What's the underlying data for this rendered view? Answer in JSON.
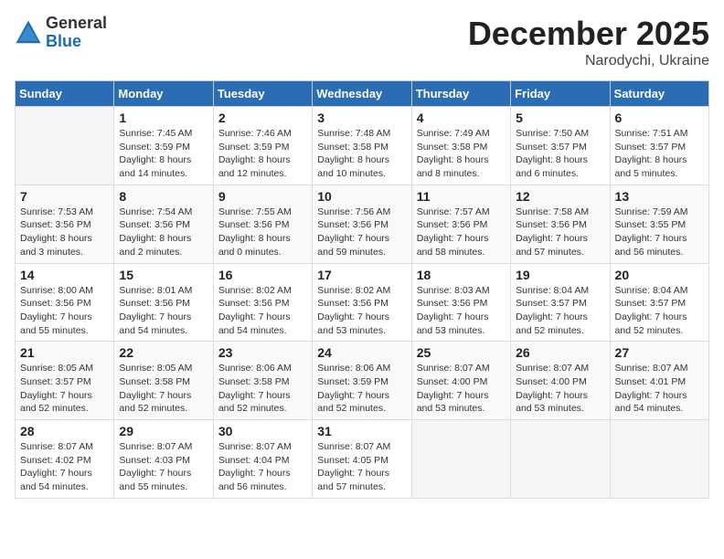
{
  "header": {
    "logo_general": "General",
    "logo_blue": "Blue",
    "month_title": "December 2025",
    "subtitle": "Narodychi, Ukraine"
  },
  "calendar": {
    "days_of_week": [
      "Sunday",
      "Monday",
      "Tuesday",
      "Wednesday",
      "Thursday",
      "Friday",
      "Saturday"
    ],
    "weeks": [
      [
        {
          "day": "",
          "info": ""
        },
        {
          "day": "1",
          "info": "Sunrise: 7:45 AM\nSunset: 3:59 PM\nDaylight: 8 hours\nand 14 minutes."
        },
        {
          "day": "2",
          "info": "Sunrise: 7:46 AM\nSunset: 3:59 PM\nDaylight: 8 hours\nand 12 minutes."
        },
        {
          "day": "3",
          "info": "Sunrise: 7:48 AM\nSunset: 3:58 PM\nDaylight: 8 hours\nand 10 minutes."
        },
        {
          "day": "4",
          "info": "Sunrise: 7:49 AM\nSunset: 3:58 PM\nDaylight: 8 hours\nand 8 minutes."
        },
        {
          "day": "5",
          "info": "Sunrise: 7:50 AM\nSunset: 3:57 PM\nDaylight: 8 hours\nand 6 minutes."
        },
        {
          "day": "6",
          "info": "Sunrise: 7:51 AM\nSunset: 3:57 PM\nDaylight: 8 hours\nand 5 minutes."
        }
      ],
      [
        {
          "day": "7",
          "info": "Sunrise: 7:53 AM\nSunset: 3:56 PM\nDaylight: 8 hours\nand 3 minutes."
        },
        {
          "day": "8",
          "info": "Sunrise: 7:54 AM\nSunset: 3:56 PM\nDaylight: 8 hours\nand 2 minutes."
        },
        {
          "day": "9",
          "info": "Sunrise: 7:55 AM\nSunset: 3:56 PM\nDaylight: 8 hours\nand 0 minutes."
        },
        {
          "day": "10",
          "info": "Sunrise: 7:56 AM\nSunset: 3:56 PM\nDaylight: 7 hours\nand 59 minutes."
        },
        {
          "day": "11",
          "info": "Sunrise: 7:57 AM\nSunset: 3:56 PM\nDaylight: 7 hours\nand 58 minutes."
        },
        {
          "day": "12",
          "info": "Sunrise: 7:58 AM\nSunset: 3:56 PM\nDaylight: 7 hours\nand 57 minutes."
        },
        {
          "day": "13",
          "info": "Sunrise: 7:59 AM\nSunset: 3:55 PM\nDaylight: 7 hours\nand 56 minutes."
        }
      ],
      [
        {
          "day": "14",
          "info": "Sunrise: 8:00 AM\nSunset: 3:56 PM\nDaylight: 7 hours\nand 55 minutes."
        },
        {
          "day": "15",
          "info": "Sunrise: 8:01 AM\nSunset: 3:56 PM\nDaylight: 7 hours\nand 54 minutes."
        },
        {
          "day": "16",
          "info": "Sunrise: 8:02 AM\nSunset: 3:56 PM\nDaylight: 7 hours\nand 54 minutes."
        },
        {
          "day": "17",
          "info": "Sunrise: 8:02 AM\nSunset: 3:56 PM\nDaylight: 7 hours\nand 53 minutes."
        },
        {
          "day": "18",
          "info": "Sunrise: 8:03 AM\nSunset: 3:56 PM\nDaylight: 7 hours\nand 53 minutes."
        },
        {
          "day": "19",
          "info": "Sunrise: 8:04 AM\nSunset: 3:57 PM\nDaylight: 7 hours\nand 52 minutes."
        },
        {
          "day": "20",
          "info": "Sunrise: 8:04 AM\nSunset: 3:57 PM\nDaylight: 7 hours\nand 52 minutes."
        }
      ],
      [
        {
          "day": "21",
          "info": "Sunrise: 8:05 AM\nSunset: 3:57 PM\nDaylight: 7 hours\nand 52 minutes."
        },
        {
          "day": "22",
          "info": "Sunrise: 8:05 AM\nSunset: 3:58 PM\nDaylight: 7 hours\nand 52 minutes."
        },
        {
          "day": "23",
          "info": "Sunrise: 8:06 AM\nSunset: 3:58 PM\nDaylight: 7 hours\nand 52 minutes."
        },
        {
          "day": "24",
          "info": "Sunrise: 8:06 AM\nSunset: 3:59 PM\nDaylight: 7 hours\nand 52 minutes."
        },
        {
          "day": "25",
          "info": "Sunrise: 8:07 AM\nSunset: 4:00 PM\nDaylight: 7 hours\nand 53 minutes."
        },
        {
          "day": "26",
          "info": "Sunrise: 8:07 AM\nSunset: 4:00 PM\nDaylight: 7 hours\nand 53 minutes."
        },
        {
          "day": "27",
          "info": "Sunrise: 8:07 AM\nSunset: 4:01 PM\nDaylight: 7 hours\nand 54 minutes."
        }
      ],
      [
        {
          "day": "28",
          "info": "Sunrise: 8:07 AM\nSunset: 4:02 PM\nDaylight: 7 hours\nand 54 minutes."
        },
        {
          "day": "29",
          "info": "Sunrise: 8:07 AM\nSunset: 4:03 PM\nDaylight: 7 hours\nand 55 minutes."
        },
        {
          "day": "30",
          "info": "Sunrise: 8:07 AM\nSunset: 4:04 PM\nDaylight: 7 hours\nand 56 minutes."
        },
        {
          "day": "31",
          "info": "Sunrise: 8:07 AM\nSunset: 4:05 PM\nDaylight: 7 hours\nand 57 minutes."
        },
        {
          "day": "",
          "info": ""
        },
        {
          "day": "",
          "info": ""
        },
        {
          "day": "",
          "info": ""
        }
      ]
    ]
  }
}
